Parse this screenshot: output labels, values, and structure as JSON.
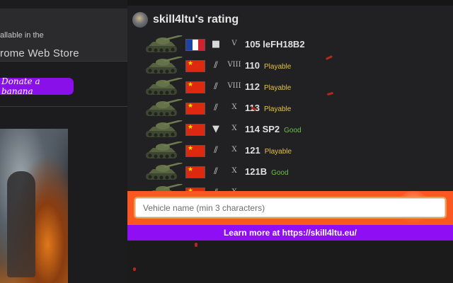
{
  "background": {
    "store_small": "allable in the",
    "store_big": "rome Web Store",
    "donate_label": "Donate a banana"
  },
  "popup": {
    "title": "skill4ltu's rating",
    "rows": [
      {
        "nation": "france",
        "class_icon": "square-icon",
        "class_glyph": "■",
        "tier": "V",
        "name": "105 leFH18B2",
        "status": ""
      },
      {
        "nation": "china",
        "class_icon": "heavy-tank-icon",
        "class_glyph": "⫽",
        "tier": "VIII",
        "name": "110",
        "status": "Playable"
      },
      {
        "nation": "china",
        "class_icon": "heavy-tank-icon",
        "class_glyph": "⫽",
        "tier": "VIII",
        "name": "112",
        "status": "Playable"
      },
      {
        "nation": "china",
        "class_icon": "heavy-tank-icon",
        "class_glyph": "⫽",
        "tier": "X",
        "name": "113",
        "status": "Playable"
      },
      {
        "nation": "china",
        "class_icon": "tank-destroyer-icon",
        "class_glyph": "▼",
        "tier": "X",
        "name": "114 SP2",
        "status": "Good"
      },
      {
        "nation": "china",
        "class_icon": "heavy-tank-icon",
        "class_glyph": "⫽",
        "tier": "X",
        "name": "121",
        "status": "Playable"
      },
      {
        "nation": "china",
        "class_icon": "heavy-tank-icon",
        "class_glyph": "⫽",
        "tier": "X",
        "name": "121B",
        "status": "Good"
      },
      {
        "nation": "china",
        "class_icon": "medium-tank-icon",
        "class_glyph": "⫽",
        "tier": "X",
        "name": "",
        "status": ""
      }
    ],
    "status_colors": {
      "Playable": "#e3c04a",
      "Good": "#6cc04a"
    },
    "search": {
      "placeholder": "Vehicle name (min 3 characters)",
      "value": ""
    },
    "learn_more": "Learn more at https://skill4ltu.eu/"
  },
  "colors": {
    "search_band": "#fb5722",
    "learn_band": "#8f0ef4",
    "donate": "#8a10ea",
    "panel": "#212123"
  }
}
